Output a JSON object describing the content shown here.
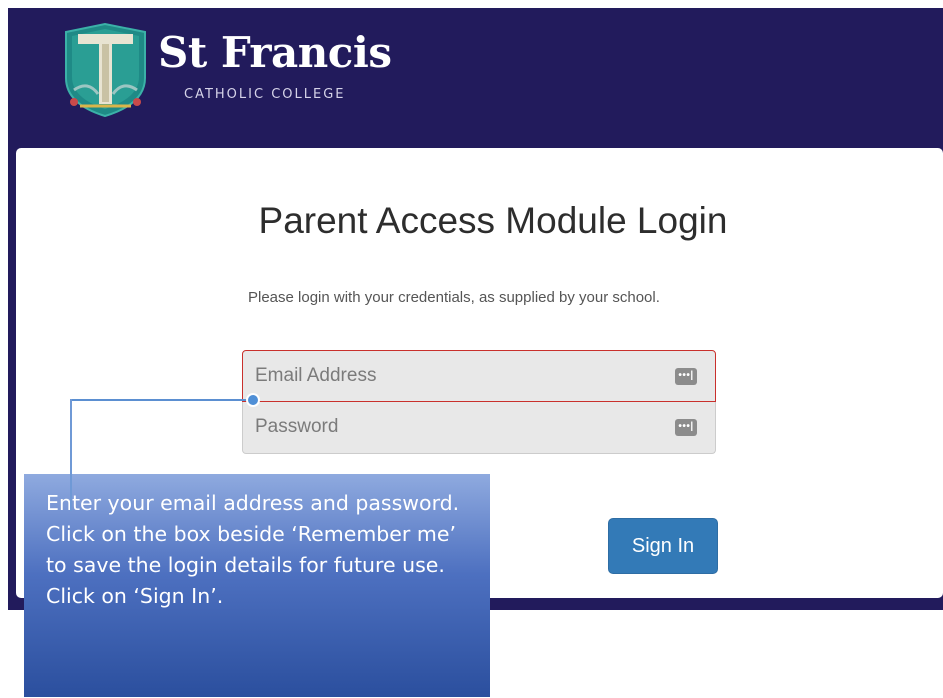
{
  "header": {
    "school_name": "St Francis",
    "school_subtitle": "CATHOLIC COLLEGE",
    "logo_icon": "school-crest-icon"
  },
  "login": {
    "title": "Parent Access Module Login",
    "intro": "Please login with your credentials, as supplied by your school.",
    "email_placeholder": "Email Address",
    "password_placeholder": "Password",
    "field_icon_glyph": "•••|",
    "sign_in_label": "Sign In"
  },
  "callout": {
    "text": "Enter your email address and password.  Click on the box beside ‘Remember me’ to save the login details for future use.  Click on ‘Sign In’."
  },
  "colors": {
    "banner": "#221b5c",
    "button": "#337ab7",
    "error_border": "#c9302c",
    "callout": "#4d70c0"
  }
}
